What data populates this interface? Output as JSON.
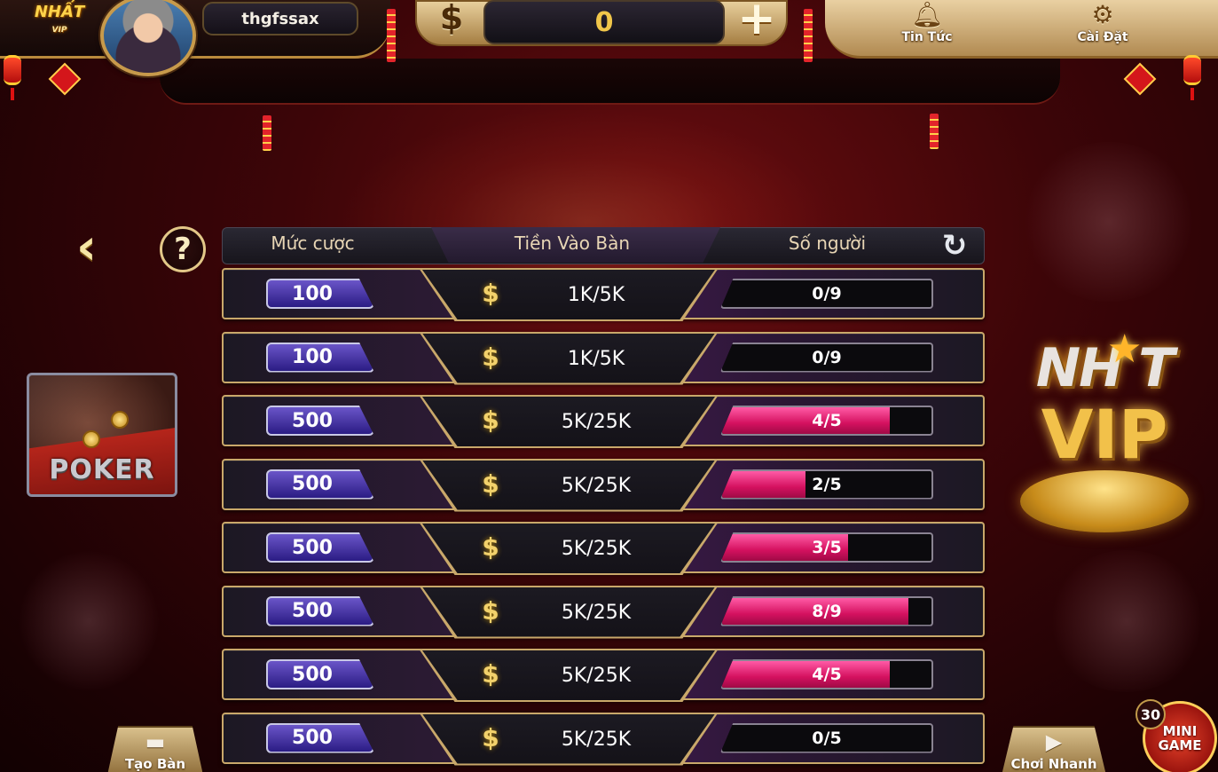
{
  "header": {
    "logo_text": "NHẤT",
    "logo_sub": "VIP",
    "username": "thgfssax",
    "coin_symbol": "$",
    "balance": "0",
    "add_symbol": "+",
    "news_label": "Tin Tức",
    "settings_label": "Cài Đặt",
    "news_icon": "bell-icon",
    "settings_icon": "gear-icon"
  },
  "nav": {
    "back_symbol": "‹",
    "help_symbol": "?"
  },
  "game": {
    "name": "POKER"
  },
  "table_list": {
    "columns": [
      "Mức cược",
      "Tiền Vào Bàn",
      "Số người"
    ],
    "currency_symbol": "$",
    "refresh_icon": "refresh-icon",
    "rows": [
      {
        "bet": "100",
        "stake": "1K/5K",
        "players": "0/9",
        "fill": 0.0
      },
      {
        "bet": "100",
        "stake": "1K/5K",
        "players": "0/9",
        "fill": 0.0
      },
      {
        "bet": "500",
        "stake": "5K/25K",
        "players": "4/5",
        "fill": 0.8
      },
      {
        "bet": "500",
        "stake": "5K/25K",
        "players": "2/5",
        "fill": 0.4
      },
      {
        "bet": "500",
        "stake": "5K/25K",
        "players": "3/5",
        "fill": 0.6
      },
      {
        "bet": "500",
        "stake": "5K/25K",
        "players": "8/9",
        "fill": 0.889
      },
      {
        "bet": "500",
        "stake": "5K/25K",
        "players": "4/5",
        "fill": 0.8
      },
      {
        "bet": "500",
        "stake": "5K/25K",
        "players": "0/5",
        "fill": 0.0
      }
    ]
  },
  "brand": {
    "line1": "NH T",
    "line2": "VIP"
  },
  "footer": {
    "create_table_label": "Tạo Bàn",
    "quick_play_label": "Chơi Nhanh",
    "minigame_line1": "MINI",
    "minigame_line2": "GAME",
    "minigame_badge": "30"
  },
  "colors": {
    "accent_gold": "#c9a86a",
    "player_fill": "#d4115f",
    "bet_badge": "#2b1c84",
    "background": "#3d0508"
  }
}
